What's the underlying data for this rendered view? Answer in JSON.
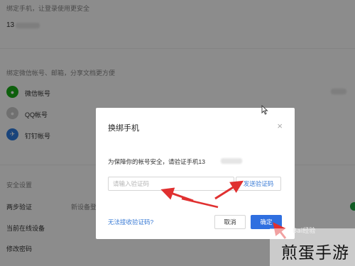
{
  "background": {
    "phone_desc": "绑定手机，让登录使用更安全",
    "phone_number": "13",
    "thirdparty_desc": "绑定微信帐号、邮箱，分享文档更方便",
    "accounts": [
      {
        "label": "微信帐号",
        "icon": "wechat-icon",
        "color": "#1aad19"
      },
      {
        "label": "QQ帐号",
        "icon": "qq-icon",
        "color": "#cccccc"
      },
      {
        "label": "钉钉帐号",
        "icon": "dingtalk-icon",
        "color": "#2f7de1"
      }
    ],
    "security_heading": "安全设置",
    "two_step_label": "两步验证",
    "two_step_value": "新设备登",
    "online_devices_label": "当前在线设备",
    "change_password_label": "修改密码"
  },
  "dialog": {
    "title": "换绑手机",
    "close_glyph": "×",
    "description": "为保障你的帐号安全，请验证手机13",
    "code_placeholder": "请输入验证码",
    "send_code_label": "发送验证码",
    "help_link": "无法接收验证码?",
    "cancel_label": "取消",
    "ok_label": "确定"
  },
  "colors": {
    "primary": "#2f6fe0",
    "link": "#3a7bd5",
    "annotation_arrow": "#e03030"
  },
  "watermark": {
    "logo_text": "Bai经验",
    "text": "煎蛋手游"
  }
}
